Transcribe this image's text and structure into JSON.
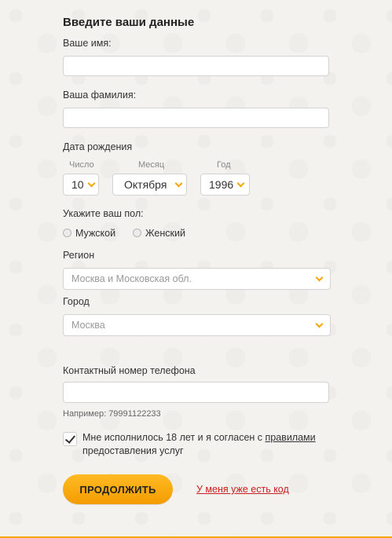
{
  "form": {
    "title": "Введите ваши данные",
    "first_name_label": "Ваше имя:",
    "first_name_value": "",
    "last_name_label": "Ваша фамилия:",
    "last_name_value": "",
    "birth_date_label": "Дата рождения",
    "day_label": "Число",
    "day_value": "10",
    "month_label": "Месяц",
    "month_value": "Октября",
    "year_label": "Год",
    "year_value": "1996",
    "gender_label": "Укажите ваш пол:",
    "gender_male": "Мужской",
    "gender_female": "Женский",
    "region_label": "Регион",
    "region_value": "Москва и Московская обл.",
    "city_label": "Город",
    "city_value": "Москва",
    "phone_label": "Контактный номер телефона",
    "phone_value": "",
    "phone_hint": "Например: 79991122233",
    "agree_text_before": "Мне исполнилось 18 лет и я согласен с ",
    "agree_link": "правилами",
    "agree_text_after": " предоставления услуг",
    "agree_checked": true,
    "submit_label": "ПРОДОЛЖИТЬ",
    "have_code_link": "У меня уже есть код"
  },
  "colors": {
    "accent": "#f5a500",
    "link": "#c81e1e",
    "background": "#f3f2ef"
  }
}
